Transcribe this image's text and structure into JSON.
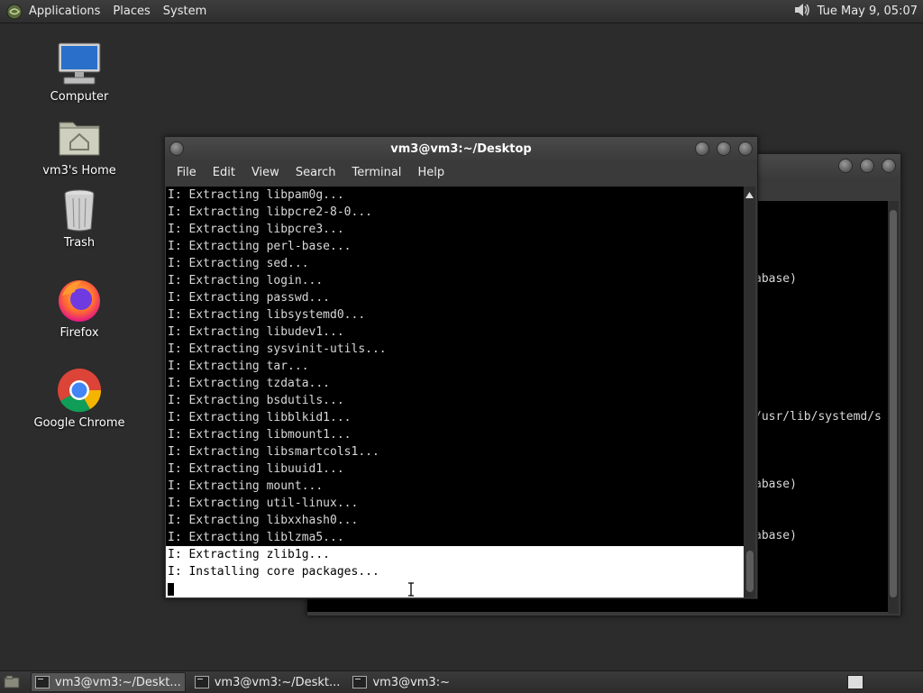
{
  "top_panel": {
    "menus": [
      "Applications",
      "Places",
      "System"
    ],
    "clock": "Tue May  9, 05:07",
    "volume_icon": "speaker-icon"
  },
  "desktop_icons": [
    {
      "label": "Computer",
      "icon": "computer-icon"
    },
    {
      "label": "vm3's Home",
      "icon": "home-folder-icon"
    },
    {
      "label": "Trash",
      "icon": "trash-icon"
    },
    {
      "label": "Firefox",
      "icon": "firefox-icon"
    },
    {
      "label": "Google Chrome",
      "icon": "chrome-icon"
    }
  ],
  "front_window": {
    "title": "vm3@vm3:~/Desktop",
    "menu": [
      "File",
      "Edit",
      "View",
      "Search",
      "Terminal",
      "Help"
    ],
    "lines": [
      "I: Extracting libpam0g...",
      "I: Extracting libpcre2-8-0...",
      "I: Extracting libpcre3...",
      "I: Extracting perl-base...",
      "I: Extracting sed...",
      "I: Extracting login...",
      "I: Extracting passwd...",
      "I: Extracting libsystemd0...",
      "I: Extracting libudev1...",
      "I: Extracting sysvinit-utils...",
      "I: Extracting tar...",
      "I: Extracting tzdata...",
      "I: Extracting bsdutils...",
      "I: Extracting libblkid1...",
      "I: Extracting libmount1...",
      "I: Extracting libsmartcols1...",
      "I: Extracting libuuid1...",
      "I: Extracting mount...",
      "I: Extracting util-linux...",
      "I: Extracting libxxhash0...",
      "I: Extracting liblzma5...",
      "I: Extracting zlib1g...",
      "I: Installing core packages..."
    ],
    "selected_from_index": 21
  },
  "back_window": {
    "visible_fragments": [
      "abase)",
      "/usr/lib/systemd/s",
      "abase)",
      "abase)"
    ]
  },
  "taskbar": {
    "tasks": [
      "vm3@vm3:~/Deskt...",
      "vm3@vm3:~/Deskt...",
      "vm3@vm3:~"
    ]
  },
  "colors": {
    "desktop": "#2b2c2b",
    "terminal_bg": "#000000",
    "terminal_fg": "#d8d8d8",
    "selection": "#ffffff"
  }
}
